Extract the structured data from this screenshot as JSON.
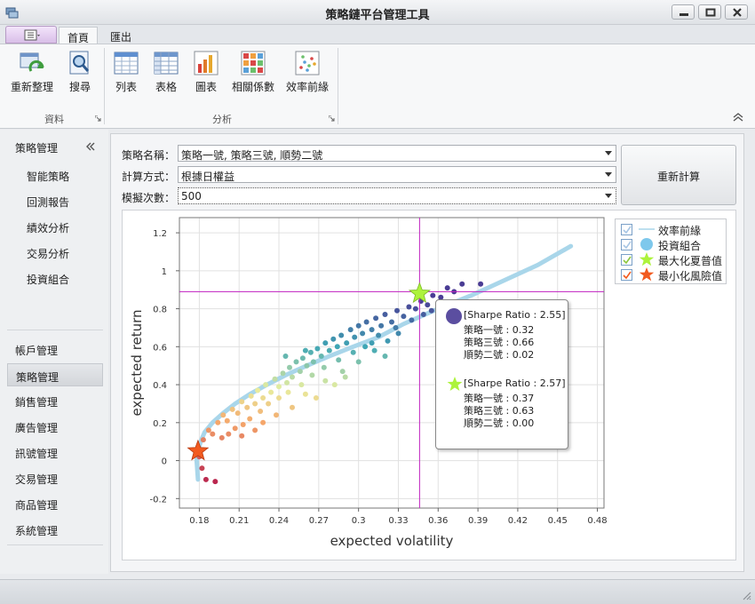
{
  "window": {
    "title": "策略鏈平台管理工具"
  },
  "ribbon": {
    "tabs": [
      {
        "label": "首頁",
        "active": true
      },
      {
        "label": "匯出",
        "active": false
      }
    ],
    "groups": [
      {
        "label": "資料",
        "buttons": [
          {
            "label": "重新整理",
            "icon": "refresh-icon"
          },
          {
            "label": "搜尋",
            "icon": "search-icon"
          }
        ]
      },
      {
        "label": "分析",
        "buttons": [
          {
            "label": "列表",
            "icon": "list-icon"
          },
          {
            "label": "表格",
            "icon": "table-icon"
          },
          {
            "label": "圖表",
            "icon": "bar-chart-icon"
          },
          {
            "label": "相關係數",
            "icon": "correlation-icon"
          },
          {
            "label": "效率前緣",
            "icon": "scatter-icon"
          }
        ]
      }
    ]
  },
  "sidebar": {
    "header": "策略管理",
    "sub_items": [
      "智能策略",
      "回測報告",
      "績效分析",
      "交易分析",
      "投資組合"
    ],
    "nav_items": [
      {
        "label": "帳戶管理",
        "active": false
      },
      {
        "label": "策略管理",
        "active": true
      },
      {
        "label": "銷售管理",
        "active": false
      },
      {
        "label": "廣告管理",
        "active": false
      },
      {
        "label": "訊號管理",
        "active": false
      },
      {
        "label": "交易管理",
        "active": false
      },
      {
        "label": "商品管理",
        "active": false
      },
      {
        "label": "系統管理",
        "active": false
      }
    ]
  },
  "form": {
    "strategy_label": "策略名稱：",
    "strategy_value": "策略一號, 策略三號, 順勢二號",
    "method_label": "計算方式：",
    "method_value": "根據日權益",
    "sims_label": "模擬次數：",
    "sims_value": "500",
    "recalc_label": "重新計算"
  },
  "legend": {
    "items": [
      {
        "label": "效率前緣",
        "checked": true,
        "color": "#a9d6ea"
      },
      {
        "label": "投資組合",
        "checked": true,
        "color": "#7ec8ec"
      },
      {
        "label": "最大化夏普值",
        "checked": true,
        "color": "#adf33c"
      },
      {
        "label": "最小化風險值",
        "checked": true,
        "color": "#f25a1f"
      }
    ]
  },
  "tooltip": {
    "blocks": [
      {
        "header": "[Sharpe Ratio : 2.55]",
        "color": "#5b4ea0",
        "lines": [
          "策略一號 : 0.32",
          "策略三號 : 0.66",
          "順勢二號 : 0.02"
        ]
      },
      {
        "header": "[Sharpe Ratio : 2.57]",
        "color": "#adf33c",
        "lines": [
          "策略一號 : 0.37",
          "策略三號 : 0.63",
          "順勢二號 : 0.00"
        ]
      }
    ]
  },
  "chart_data": {
    "type": "scatter",
    "xlabel": "expected volatility",
    "ylabel": "expected return",
    "xlim": [
      0.165,
      0.485
    ],
    "ylim": [
      -0.25,
      1.28
    ],
    "x_ticks": [
      0.18,
      0.21,
      0.24,
      0.27,
      0.3,
      0.33,
      0.36,
      0.39,
      0.42,
      0.45,
      0.48
    ],
    "x_tick_labels": [
      "0.18",
      "0.21",
      "0.24",
      "0.27",
      "0.3",
      "0.33",
      "0.36",
      "0.39",
      "0.42",
      "0.45",
      "0.48"
    ],
    "y_ticks": [
      -0.2,
      0,
      0.2,
      0.4,
      0.6,
      0.8,
      1,
      1.2
    ],
    "y_tick_labels": [
      "-0.2",
      "0",
      "0.2",
      "0.4",
      "0.6",
      "0.8",
      "1",
      "1.2"
    ],
    "grid": true,
    "frontier": [
      [
        0.179,
        -0.1
      ],
      [
        0.178,
        0.0
      ],
      [
        0.179,
        0.05
      ],
      [
        0.181,
        0.1
      ],
      [
        0.184,
        0.15
      ],
      [
        0.19,
        0.2
      ],
      [
        0.198,
        0.25
      ],
      [
        0.207,
        0.3
      ],
      [
        0.218,
        0.35
      ],
      [
        0.231,
        0.4
      ],
      [
        0.245,
        0.45
      ],
      [
        0.261,
        0.5
      ],
      [
        0.278,
        0.55
      ],
      [
        0.296,
        0.6
      ],
      [
        0.315,
        0.65
      ],
      [
        0.334,
        0.72
      ],
      [
        0.36,
        0.8
      ],
      [
        0.385,
        0.87
      ],
      [
        0.41,
        0.95
      ],
      [
        0.435,
        1.03
      ],
      [
        0.46,
        1.13
      ]
    ],
    "portfolios": [
      [
        0.18,
        0.02
      ],
      [
        0.182,
        -0.04
      ],
      [
        0.185,
        -0.1
      ],
      [
        0.192,
        -0.11
      ],
      [
        0.183,
        0.11
      ],
      [
        0.187,
        0.16
      ],
      [
        0.19,
        0.14
      ],
      [
        0.194,
        0.2
      ],
      [
        0.198,
        0.24
      ],
      [
        0.201,
        0.21
      ],
      [
        0.205,
        0.27
      ],
      [
        0.209,
        0.25
      ],
      [
        0.212,
        0.31
      ],
      [
        0.216,
        0.28
      ],
      [
        0.219,
        0.34
      ],
      [
        0.222,
        0.3
      ],
      [
        0.224,
        0.37
      ],
      [
        0.228,
        0.33
      ],
      [
        0.23,
        0.4
      ],
      [
        0.234,
        0.36
      ],
      [
        0.237,
        0.43
      ],
      [
        0.24,
        0.39
      ],
      [
        0.243,
        0.46
      ],
      [
        0.246,
        0.41
      ],
      [
        0.248,
        0.49
      ],
      [
        0.25,
        0.44
      ],
      [
        0.253,
        0.52
      ],
      [
        0.256,
        0.47
      ],
      [
        0.258,
        0.54
      ],
      [
        0.261,
        0.5
      ],
      [
        0.264,
        0.57
      ],
      [
        0.266,
        0.52
      ],
      [
        0.269,
        0.59
      ],
      [
        0.272,
        0.55
      ],
      [
        0.275,
        0.62
      ],
      [
        0.278,
        0.58
      ],
      [
        0.281,
        0.64
      ],
      [
        0.284,
        0.6
      ],
      [
        0.287,
        0.66
      ],
      [
        0.291,
        0.62
      ],
      [
        0.294,
        0.69
      ],
      [
        0.297,
        0.65
      ],
      [
        0.3,
        0.71
      ],
      [
        0.303,
        0.67
      ],
      [
        0.306,
        0.73
      ],
      [
        0.31,
        0.69
      ],
      [
        0.313,
        0.75
      ],
      [
        0.317,
        0.71
      ],
      [
        0.32,
        0.77
      ],
      [
        0.325,
        0.73
      ],
      [
        0.329,
        0.79
      ],
      [
        0.334,
        0.76
      ],
      [
        0.338,
        0.81
      ],
      [
        0.343,
        0.8
      ],
      [
        0.347,
        0.84
      ],
      [
        0.352,
        0.82
      ],
      [
        0.356,
        0.87
      ],
      [
        0.362,
        0.86
      ],
      [
        0.367,
        0.91
      ],
      [
        0.372,
        0.89
      ],
      [
        0.378,
        0.93
      ],
      [
        0.392,
        0.93
      ],
      [
        0.34,
        0.74
      ],
      [
        0.328,
        0.7
      ],
      [
        0.315,
        0.66
      ],
      [
        0.305,
        0.6
      ],
      [
        0.296,
        0.57
      ],
      [
        0.285,
        0.53
      ],
      [
        0.274,
        0.49
      ],
      [
        0.265,
        0.45
      ],
      [
        0.257,
        0.4
      ],
      [
        0.247,
        0.36
      ],
      [
        0.24,
        0.33
      ],
      [
        0.232,
        0.3
      ],
      [
        0.226,
        0.26
      ],
      [
        0.218,
        0.22
      ],
      [
        0.213,
        0.19
      ],
      [
        0.207,
        0.17
      ],
      [
        0.202,
        0.14
      ],
      [
        0.197,
        0.12
      ],
      [
        0.26,
        0.35
      ],
      [
        0.275,
        0.42
      ],
      [
        0.288,
        0.47
      ],
      [
        0.3,
        0.52
      ],
      [
        0.312,
        0.58
      ],
      [
        0.322,
        0.63
      ],
      [
        0.33,
        0.67
      ],
      [
        0.282,
        0.4
      ],
      [
        0.268,
        0.33
      ],
      [
        0.25,
        0.28
      ],
      [
        0.238,
        0.24
      ],
      [
        0.228,
        0.2
      ],
      [
        0.222,
        0.16
      ],
      [
        0.212,
        0.13
      ],
      [
        0.245,
        0.55
      ],
      [
        0.26,
        0.58
      ],
      [
        0.31,
        0.62
      ],
      [
        0.32,
        0.55
      ],
      [
        0.29,
        0.44
      ],
      [
        0.355,
        0.79
      ],
      [
        0.349,
        0.77
      ],
      [
        0.36,
        0.83
      ]
    ],
    "max_sharpe": [
      0.346,
      0.88
    ],
    "min_risk": [
      0.179,
      0.05
    ],
    "crosshair": [
      0.346,
      0.89
    ],
    "colors": {
      "low": "#b2164a",
      "mid_low": "#f5a66a",
      "mid": "#e8efa0",
      "mid_high": "#3fa6b5",
      "high": "#4a3c94",
      "frontier": "#a9d6ea",
      "crosshair": "#c020c0",
      "max_sharpe": "#adf33c",
      "min_risk": "#f25a1f"
    }
  }
}
